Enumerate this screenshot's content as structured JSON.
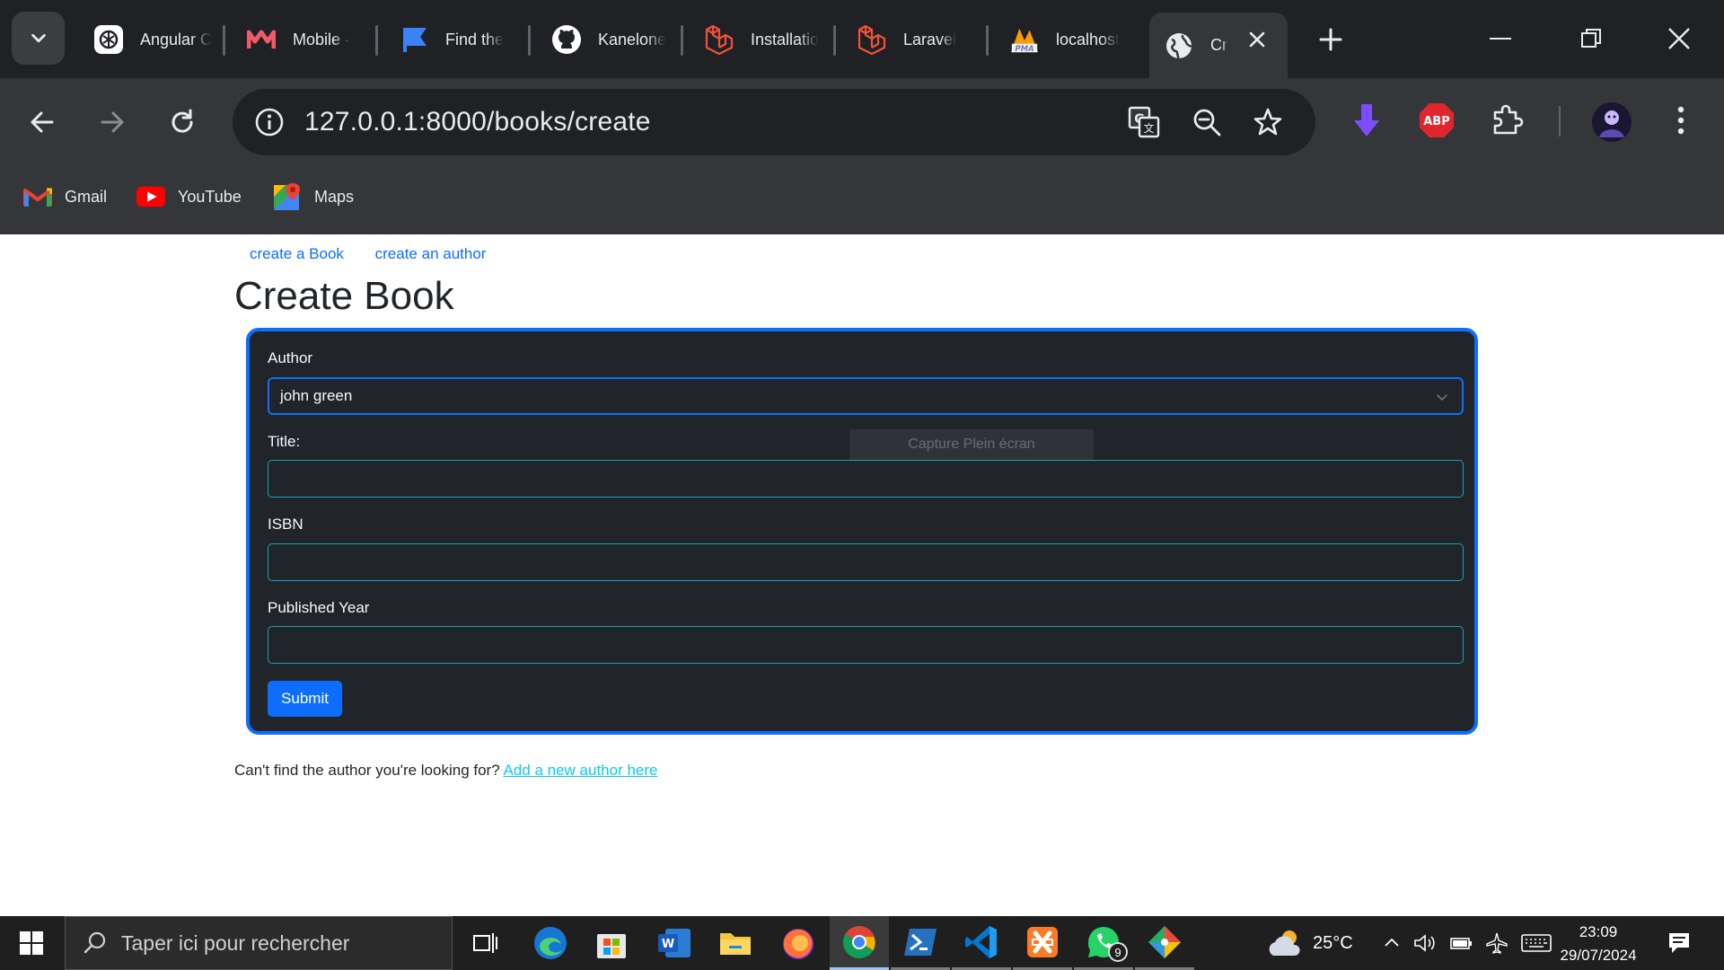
{
  "browser": {
    "tabs": [
      {
        "title": "Angular C",
        "icon": "openai-icon"
      },
      {
        "title": "Mobile -",
        "icon": "m-logo-icon"
      },
      {
        "title": "Find the",
        "icon": "flag-icon"
      },
      {
        "title": "Kanelone",
        "icon": "github-icon"
      },
      {
        "title": "Installatio",
        "icon": "laravel-icon"
      },
      {
        "title": "Laravel",
        "icon": "laravel-icon"
      },
      {
        "title": "localhost",
        "icon": "phpmyadmin-icon"
      },
      {
        "title": "Cr",
        "icon": "globe-icon",
        "active": true
      }
    ],
    "url": "127.0.0.1:8000/books/create",
    "bookmarks": [
      {
        "label": "Gmail",
        "icon": "gmail-icon"
      },
      {
        "label": "YouTube",
        "icon": "youtube-icon"
      },
      {
        "label": "Maps",
        "icon": "maps-icon"
      }
    ],
    "extensions": [
      "download-ext-icon",
      "abp-icon",
      "puzzle-icon"
    ],
    "abp_label": "ABP"
  },
  "page": {
    "nav_links": [
      "create a Book",
      "create an author"
    ],
    "title": "Create Book",
    "form": {
      "author_label": "Author",
      "author_value": "john green",
      "title_label": "Title:",
      "isbn_label": "ISBN",
      "year_label": "Published Year",
      "submit_label": "Submit"
    },
    "overlay_text": "Capture Plein écran",
    "footer_text": "Can't find the author you're looking for?",
    "footer_link": "Add a new author here",
    "colors": {
      "primary": "#0d6efd",
      "card_bg": "#212529",
      "link_info": "#0dcaf0"
    }
  },
  "taskbar": {
    "search_placeholder": "Taper ici pour rechercher",
    "weather": "25°C",
    "time": "23:09",
    "date": "29/07/2024",
    "whatsapp_badge": "9"
  }
}
